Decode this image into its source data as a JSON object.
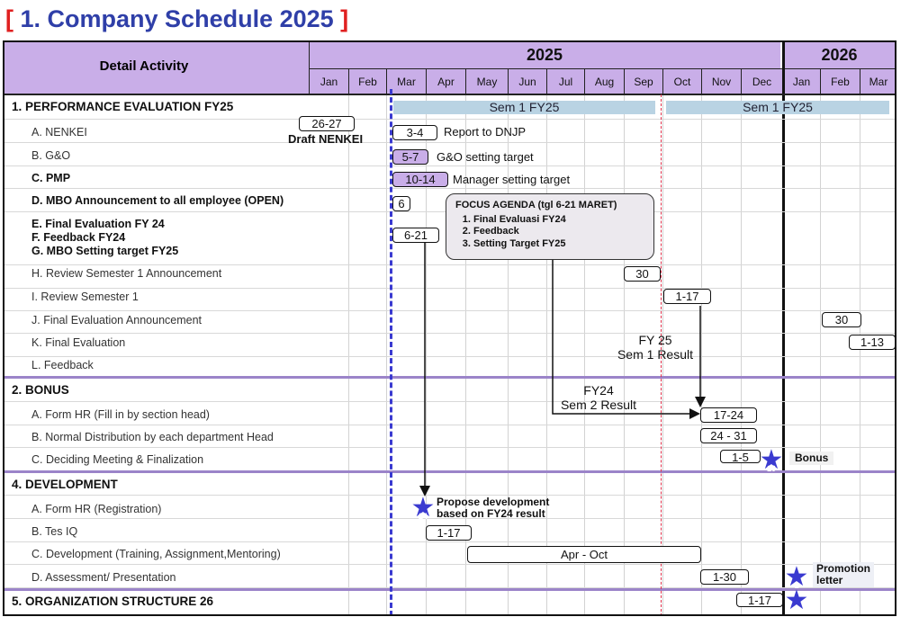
{
  "title_bracket_open": "[",
  "title": "1. Company Schedule 2025",
  "title_bracket_close": "]",
  "header": {
    "activity": "Detail Activity",
    "year_2025": "2025",
    "year_2026": "2026",
    "months": [
      "Jan",
      "Feb",
      "Mar",
      "Apr",
      "May",
      "Jun",
      "Jul",
      "Aug",
      "Sep",
      "Oct",
      "Nov",
      "Dec",
      "Jan",
      "Feb",
      "Mar"
    ]
  },
  "rows": {
    "perf": "1. PERFORMANCE EVALUATION FY25",
    "nenkei": "A.  NENKEI",
    "go": "B.  G&O",
    "pmp": "C.  PMP",
    "mbo": "D.  MBO Announcement to all employee (OPEN)",
    "final_e": "E.  Final Evaluation FY 24",
    "feedback_f": "F.  Feedback FY24",
    "mbo_g": "G.  MBO Setting target FY25",
    "rev_ann": "H.  Review Semester 1 Announcement",
    "rev_sem": "I.   Review Semester 1",
    "final_ann": "J.   Final Evaluation Announcement",
    "final_eval": "K.  Final Evaluation",
    "feedback_l": "L.   Feedback",
    "bonus": "2. BONUS",
    "form_hr": "A.  Form HR (Fill in by section head)",
    "norm_dist": "B.  Normal Distribution by each department Head",
    "deciding": "C.  Deciding Meeting & Finalization",
    "dev": "4.  DEVELOPMENT",
    "form_hr_reg": "A.  Form HR (Registration)",
    "tes_iq": "B.  Tes IQ",
    "development": "C.  Development (Training, Assignment,Mentoring)",
    "assessment": "D.  Assessment/ Presentation",
    "org": "5.   ORGANIZATION STRUCTURE 26"
  },
  "bars": {
    "sem1_a": "Sem 1 FY25",
    "sem1_b": "Sem 1 FY25",
    "nenkei_date": "26-27",
    "nenkei_note": "Draft NENKEI",
    "go_date": "3-4",
    "go_note": "Report to DNJP",
    "pmp_date": "5-7",
    "pmp_note": "G&O setting target",
    "mbo_date": "10-14",
    "mbo_note": "Manager setting target",
    "open_date": "6",
    "efg_date": "6-21",
    "rev_ann_date": "30",
    "rev_sem_date": "1-17",
    "final_ann_date": "30",
    "final_eval_date": "1-13",
    "form_hr_date": "17-24",
    "norm_date": "24 - 31",
    "deciding_date": "1-5",
    "tes_iq_date": "1-17",
    "development_date": "Apr - Oct",
    "assessment_date": "1-30",
    "org_date": "1-17"
  },
  "focus": {
    "title": "FOCUS AGENDA (tgl 6-21 MARET)",
    "items": [
      "Final Evaluasi FY24",
      "Feedback",
      "Setting Target FY25"
    ]
  },
  "annotations": {
    "fy25_line1": "FY 25",
    "fy25_line2": "Sem 1 Result",
    "fy24_line1": "FY24",
    "fy24_line2": "Sem 2 Result",
    "bonus": "Bonus",
    "propose_line1": "Propose development",
    "propose_line2": "based on FY24 result",
    "promotion_line1": "Promotion",
    "promotion_line2": "letter"
  },
  "stars": {
    "bonus_num": "10",
    "dev_num": "24",
    "promo_num": "1",
    "org_num": "1"
  },
  "colors": {
    "title": "#2f3fa8",
    "bracket": "#e02020",
    "header": "#c9aee8",
    "semester_bar": "#b9d3e3",
    "today_line": "#3a3ad0",
    "oct_line": "#e0304a",
    "star": "#3a3ad0"
  }
}
